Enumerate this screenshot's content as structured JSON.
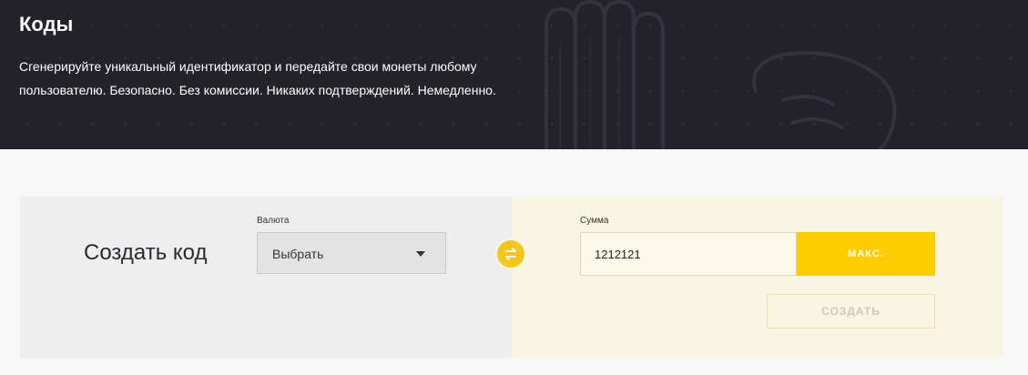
{
  "header": {
    "title": "Коды",
    "description": "Сгенерируйте уникальный идентификатор и передайте свои монеты любому пользователю. Безопасно. Без комиссии. Никаких подтверждений. Немедленно."
  },
  "form": {
    "title": "Создать код",
    "currency": {
      "label": "Валюта",
      "selected": "Выбрать"
    },
    "amount": {
      "label": "Сумма",
      "value": "1212121",
      "max_label": "МАКС."
    },
    "create_label": "СОЗДАТЬ"
  },
  "colors": {
    "header_bg": "#23222b",
    "accent": "#ffcc00",
    "swap_icon": "#f4c51b",
    "left_panel_bg": "#eeeeee",
    "right_panel_bg": "#faf5e2"
  },
  "icons": [
    "swap-icon",
    "chevron-down-icon"
  ]
}
